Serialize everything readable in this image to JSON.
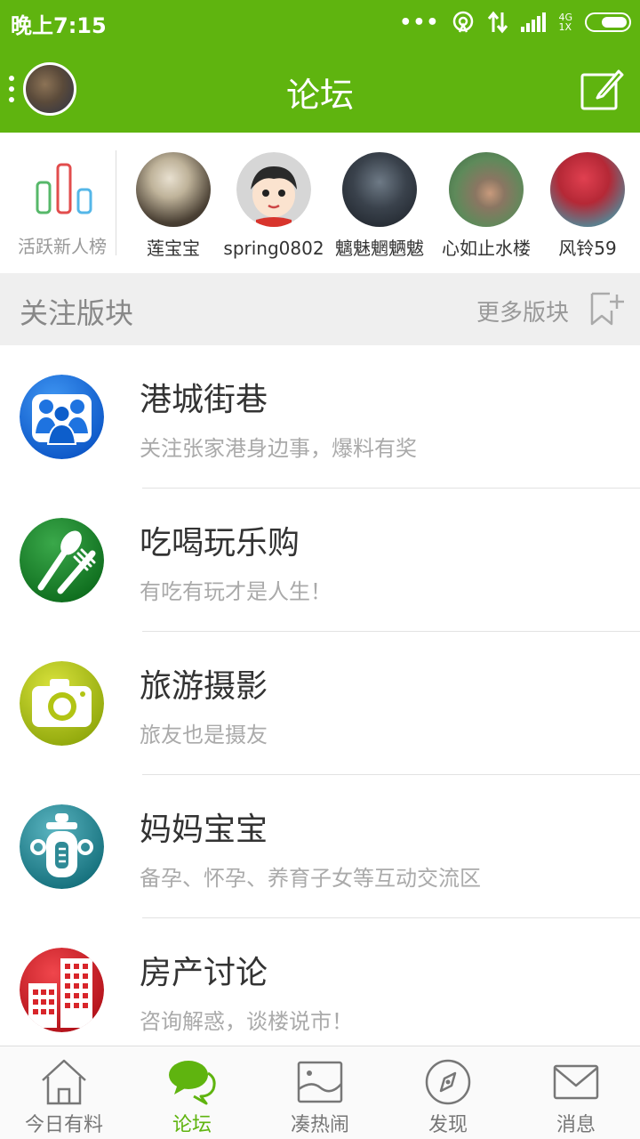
{
  "status_bar": {
    "time": "晚上7:15",
    "dots": "•••",
    "net_top": "4G",
    "net_bottom": "1X"
  },
  "header": {
    "title": "论坛"
  },
  "active_users": {
    "rank_label": "活跃新人榜",
    "users": [
      {
        "name": "莲宝宝"
      },
      {
        "name": "spring0802"
      },
      {
        "name": "魑魅魍魉魃"
      },
      {
        "name": "心如止水楼"
      },
      {
        "name": "风铃59"
      }
    ]
  },
  "section": {
    "title": "关注版块",
    "more_label": "更多版块"
  },
  "forums": [
    {
      "name": "港城街巷",
      "desc": "关注张家港身边事，爆料有奖",
      "icon": "people-icon",
      "color": "#1e73e0"
    },
    {
      "name": "吃喝玩乐购",
      "desc": "有吃有玩才是人生！",
      "icon": "utensils-icon",
      "color": "#1e8a2e"
    },
    {
      "name": "旅游摄影",
      "desc": "旅友也是摄友",
      "icon": "camera-icon",
      "color": "#b2c414"
    },
    {
      "name": "妈妈宝宝",
      "desc": "备孕、怀孕、养育子女等互动交流区",
      "icon": "baby-bottle-icon",
      "color": "#2f8a96"
    },
    {
      "name": "房产讨论",
      "desc": "咨询解惑，谈楼说市！",
      "icon": "building-icon",
      "color": "#d8252a"
    }
  ],
  "bottom_nav": [
    {
      "label": "今日有料",
      "icon": "home-icon",
      "active": false
    },
    {
      "label": "论坛",
      "icon": "chat-icon",
      "active": true
    },
    {
      "label": "凑热闹",
      "icon": "picture-icon",
      "active": false
    },
    {
      "label": "发现",
      "icon": "compass-icon",
      "active": false
    },
    {
      "label": "消息",
      "icon": "mail-icon",
      "active": false
    }
  ],
  "colors": {
    "brand": "#5fb40f",
    "section_bg": "#efefef"
  }
}
